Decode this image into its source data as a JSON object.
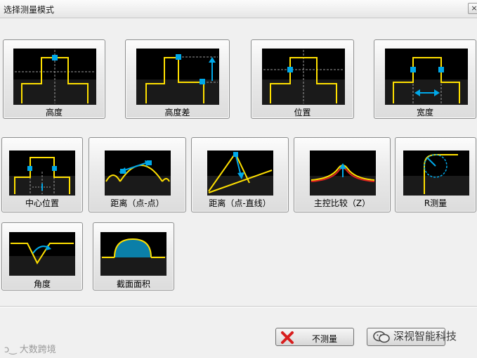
{
  "window": {
    "title": "选择测量模式",
    "close_label": "×"
  },
  "modes": [
    {
      "label": "高度"
    },
    {
      "label": "高度差"
    },
    {
      "label": "位置"
    },
    {
      "label": "宽度"
    },
    {
      "label": "中心位置"
    },
    {
      "label": "距离（点-点）"
    },
    {
      "label": "距离（点-直线）"
    },
    {
      "label": "主控比较（Z）"
    },
    {
      "label": "R测量"
    },
    {
      "label": "角度"
    },
    {
      "label": "截面面积"
    }
  ],
  "footer": {
    "no_measure_label": "不测量"
  },
  "watermark": {
    "right_text": "深视智能科技",
    "left_text": "大数跨境"
  },
  "colors": {
    "profile": "#ffe000",
    "marker": "#00a8e8",
    "guide": "#9a9a9a",
    "accent_red": "#e02020"
  }
}
